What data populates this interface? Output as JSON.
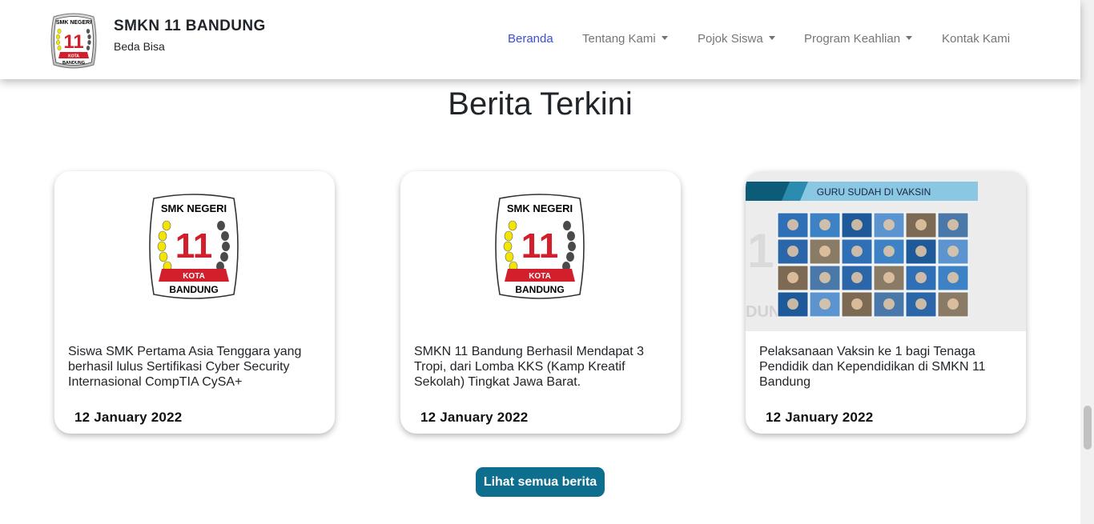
{
  "header": {
    "school_name": "SMKN 11 BANDUNG",
    "tagline": "Beda Bisa",
    "logo": {
      "top_text": "SMK NEGERI",
      "number": "11",
      "ribbon_text": "KOTA",
      "bottom_text": "BANDUNG"
    },
    "nav": [
      {
        "label": "Beranda",
        "active": true,
        "dropdown": false
      },
      {
        "label": "Tentang Kami",
        "active": false,
        "dropdown": true
      },
      {
        "label": "Pojok Siswa",
        "active": false,
        "dropdown": true
      },
      {
        "label": "Program Keahlian",
        "active": false,
        "dropdown": true
      },
      {
        "label": "Kontak Kami",
        "active": false,
        "dropdown": false
      }
    ]
  },
  "news": {
    "title": "Berita Terkini",
    "cards": [
      {
        "image": "school-logo",
        "text": "Siswa SMK Pertama Asia Tenggara yang berhasil lulus Sertifikasi Cyber Security Internasional CompTIA CySA+",
        "date": "12 January 2022"
      },
      {
        "image": "school-logo",
        "text": "SMKN 11 Bandung Berhasil Mendapat 3 Tropi, dari Lomba KKS (Kamp Kreatif Sekolah) Tingkat Jawa Barat.",
        "date": "12 January 2022"
      },
      {
        "image": "vaccine-collage",
        "image_caption": "GURU SUDAH DI VAKSIN",
        "text": "Pelaksanaan Vaksin ke 1 bagi Tenaga Pendidik dan Kependidikan di SMKN 11 Bandung",
        "date": "12 January 2022"
      }
    ],
    "see_all_label": "Lihat semua berita"
  },
  "colors": {
    "accent": "#0d6e8e",
    "nav_active": "#3b4ddc",
    "logo_red": "#d21f2b",
    "logo_yellow": "#f2e600"
  }
}
